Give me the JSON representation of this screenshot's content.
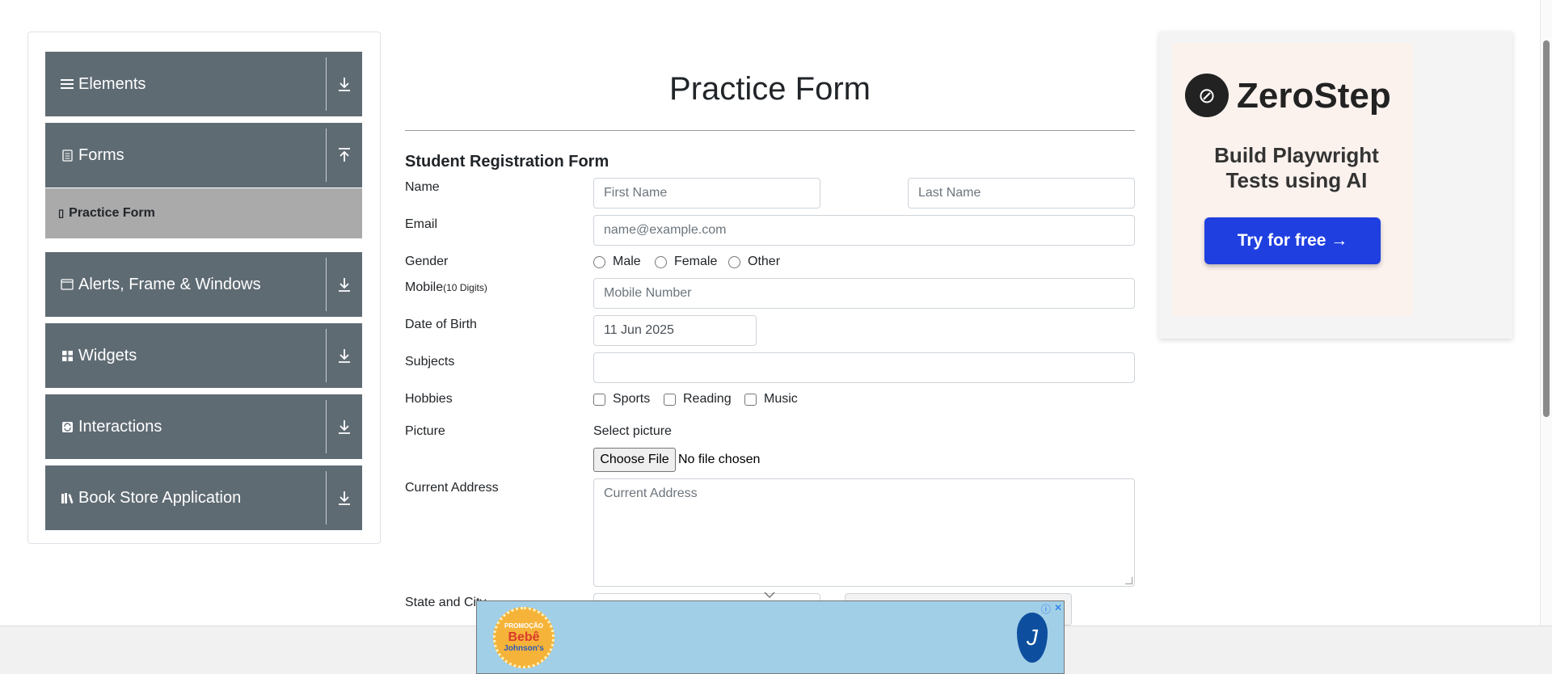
{
  "sidebar": {
    "groups": [
      {
        "label": "Elements",
        "icon": "list-icon"
      },
      {
        "label": "Forms",
        "icon": "document-icon",
        "expanded": true
      },
      {
        "label": "Alerts, Frame & Windows",
        "icon": "window-icon"
      },
      {
        "label": "Widgets",
        "icon": "grid-icon"
      },
      {
        "label": "Interactions",
        "icon": "refresh-icon"
      },
      {
        "label": "Book Store Application",
        "icon": "books-icon"
      }
    ],
    "active_item": "Practice Form"
  },
  "form": {
    "title": "Practice Form",
    "subtitle": "Student Registration Form",
    "name_label": "Name",
    "first_name_placeholder": "First Name",
    "last_name_placeholder": "Last Name",
    "email_label": "Email",
    "email_placeholder": "name@example.com",
    "gender_label": "Gender",
    "gender_options": [
      "Male",
      "Female",
      "Other"
    ],
    "mobile_label": "Mobile",
    "mobile_hint": "(10 Digits)",
    "mobile_placeholder": "Mobile Number",
    "dob_label": "Date of Birth",
    "dob_value": "11 Jun 2025",
    "subjects_label": "Subjects",
    "hobbies_label": "Hobbies",
    "hobby_options": [
      "Sports",
      "Reading",
      "Music"
    ],
    "picture_label": "Picture",
    "picture_prompt": "Select picture",
    "choose_file_label": "Choose File",
    "no_file_text": "No file chosen",
    "address_label": "Current Address",
    "address_placeholder": "Current Address",
    "state_city_label": "State and City"
  },
  "ad": {
    "brand": "ZeroStep",
    "headline_1": "Build Playwright",
    "headline_2": "Tests using AI",
    "cta": "Try for free →"
  },
  "banner": {
    "badge_line1": "PROMOÇÃO",
    "badge_line2": "Bebê",
    "badge_line3": "Johnson's",
    "brand_glyph": "J"
  },
  "colors": {
    "sidebar_group_bg": "#5f6b73",
    "sidebar_active_bg": "#aaaaaa",
    "cta_blue": "#1f3fe0"
  }
}
